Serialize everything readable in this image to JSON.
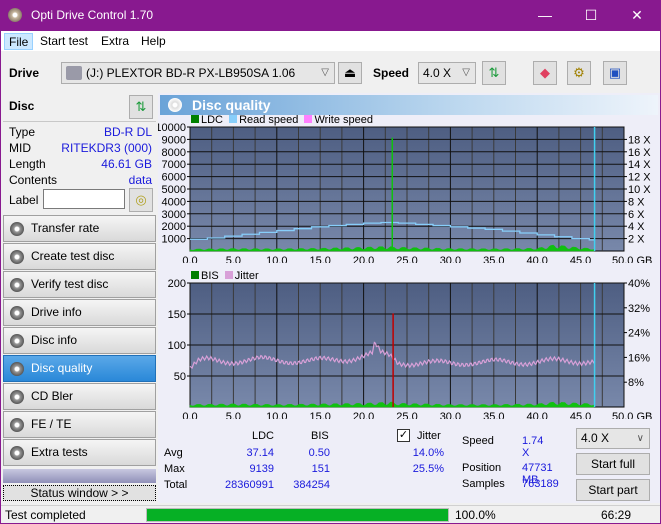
{
  "window": {
    "title": "Opti Drive Control 1.70",
    "minimize": "—",
    "maximize": "☐",
    "close": "✕"
  },
  "menu": [
    {
      "label": "File"
    },
    {
      "label": "Start test"
    },
    {
      "label": "Extra"
    },
    {
      "label": "Help"
    }
  ],
  "toolbar": {
    "drive_label": "Drive",
    "drive_value": "(J:)  PLEXTOR BD-R  PX-LB950SA 1.06",
    "speed_label": "Speed",
    "speed_value": "4.0 X"
  },
  "disc": {
    "title": "Disc",
    "fields": [
      {
        "label": "Type",
        "value": "BD-R DL"
      },
      {
        "label": "MID",
        "value": "RITEKDR3 (000)"
      },
      {
        "label": "Length",
        "value": "46.61 GB"
      },
      {
        "label": "Contents",
        "value": "data"
      }
    ],
    "label_field_label": "Label",
    "label_value": ""
  },
  "nav": [
    {
      "label": "Transfer rate",
      "selected": false
    },
    {
      "label": "Create test disc",
      "selected": false
    },
    {
      "label": "Verify test disc",
      "selected": false
    },
    {
      "label": "Drive info",
      "selected": false
    },
    {
      "label": "Disc info",
      "selected": false
    },
    {
      "label": "Disc quality",
      "selected": true
    },
    {
      "label": "CD Bler",
      "selected": false
    },
    {
      "label": "FE / TE",
      "selected": false
    },
    {
      "label": "Extra tests",
      "selected": false
    }
  ],
  "status_window_button": "Status window > >",
  "panel_title": "Disc quality",
  "chart_data": [
    {
      "type": "line",
      "title": "LDC / Read speed",
      "legend": [
        {
          "name": "LDC",
          "color": "#008000"
        },
        {
          "name": "Read speed",
          "color": "#87cefa"
        },
        {
          "name": "Write speed",
          "color": "#ff80ff"
        }
      ],
      "x_ticks": [
        "0.0",
        "5.0",
        "10.0",
        "15.0",
        "20.0",
        "25.0",
        "30.0",
        "35.0",
        "40.0",
        "45.0",
        "50.0 GB"
      ],
      "xlim": [
        0,
        50
      ],
      "y_left_ticks": [
        "10000",
        "9000",
        "8000",
        "7000",
        "6000",
        "5000",
        "4000",
        "3000",
        "2000",
        "1000"
      ],
      "ylim_left": [
        0,
        10000
      ],
      "y_right_ticks": [
        "18 X",
        "16 X",
        "14 X",
        "12 X",
        "10 X",
        "8 X",
        "6 X",
        "4 X",
        "2 X"
      ],
      "ylim_right": [
        0,
        20
      ],
      "series": [
        {
          "name": "Read speed",
          "unit": "X",
          "x": [
            0,
            2,
            4,
            6,
            8,
            10,
            12,
            14,
            16,
            18,
            20,
            22,
            23.3,
            24,
            26,
            28,
            30,
            32,
            34,
            36,
            38,
            40,
            42,
            44,
            46,
            46.6
          ],
          "y": [
            1.9,
            2.1,
            2.4,
            2.7,
            3.0,
            3.3,
            3.6,
            3.9,
            4.1,
            4.3,
            4.5,
            4.6,
            4.6,
            4.5,
            4.3,
            4.1,
            3.9,
            3.7,
            3.5,
            3.2,
            2.9,
            2.6,
            2.3,
            2.0,
            1.8,
            1.7
          ]
        },
        {
          "name": "LDC",
          "x": [
            0,
            5,
            10,
            15,
            20,
            22,
            23.3,
            24,
            30,
            35,
            40,
            42,
            45,
            46.6
          ],
          "y": [
            150,
            200,
            180,
            220,
            300,
            350,
            9139,
            300,
            200,
            180,
            220,
            500,
            250,
            200
          ]
        }
      ],
      "end_marker_x": 46.61
    },
    {
      "type": "line",
      "title": "BIS / Jitter",
      "legend": [
        {
          "name": "BIS",
          "color": "#008000"
        },
        {
          "name": "Jitter",
          "color": "#d8a0d8"
        }
      ],
      "x_ticks": [
        "0.0",
        "5.0",
        "10.0",
        "15.0",
        "20.0",
        "25.0",
        "30.0",
        "35.0",
        "40.0",
        "45.0",
        "50.0 GB"
      ],
      "xlim": [
        0,
        50
      ],
      "y_left_ticks": [
        "200",
        "150",
        "100",
        "50"
      ],
      "ylim_left": [
        0,
        200
      ],
      "y_right_ticks": [
        "40%",
        "32%",
        "24%",
        "16%",
        "8%"
      ],
      "ylim_right": [
        0,
        40
      ],
      "series": [
        {
          "name": "Jitter",
          "unit": "%",
          "x": [
            0,
            1,
            2,
            4,
            6,
            8,
            10,
            12,
            14,
            16,
            18,
            20,
            21,
            21.3,
            22,
            23,
            23.3,
            24,
            26,
            28,
            30,
            32,
            34,
            36,
            38,
            40,
            42,
            44,
            46,
            46.6
          ],
          "y": [
            12.5,
            14.5,
            15,
            14.8,
            15,
            15.2,
            15,
            15,
            14.8,
            15,
            15.5,
            16.5,
            17,
            20,
            17,
            16.5,
            16,
            14.5,
            14.2,
            14,
            14.2,
            14.5,
            14.3,
            14.5,
            14.6,
            14.5,
            14.7,
            14.8,
            15,
            14.8
          ]
        },
        {
          "name": "BIS",
          "x": [
            0,
            5,
            10,
            15,
            20,
            23.3,
            23.4,
            24,
            30,
            35,
            40,
            42,
            46.6
          ],
          "y": [
            4,
            5,
            4,
            5,
            6,
            8,
            151,
            6,
            4,
            4,
            5,
            8,
            5
          ]
        }
      ],
      "end_marker_x": 46.61
    }
  ],
  "stats": {
    "col_ldc": "LDC",
    "col_bis": "BIS",
    "jitter_checkbox_label": "Jitter",
    "jitter_checked": true,
    "rows": [
      {
        "label": "Avg",
        "ldc": "37.14",
        "bis": "0.50",
        "jitter": "14.0%"
      },
      {
        "label": "Max",
        "ldc": "9139",
        "bis": "151",
        "jitter": "25.5%"
      },
      {
        "label": "Total",
        "ldc": "28360991",
        "bis": "384254",
        "jitter": ""
      }
    ],
    "speed_label": "Speed",
    "speed_value": "1.74 X",
    "position_label": "Position",
    "position_value": "47731 MB",
    "samples_label": "Samples",
    "samples_value": "763189",
    "speed_select": "4.0 X",
    "start_full": "Start full",
    "start_part": "Start part"
  },
  "status": {
    "text": "Test completed",
    "progress": 100.0,
    "progress_text": "100.0%",
    "time": "66:29"
  }
}
